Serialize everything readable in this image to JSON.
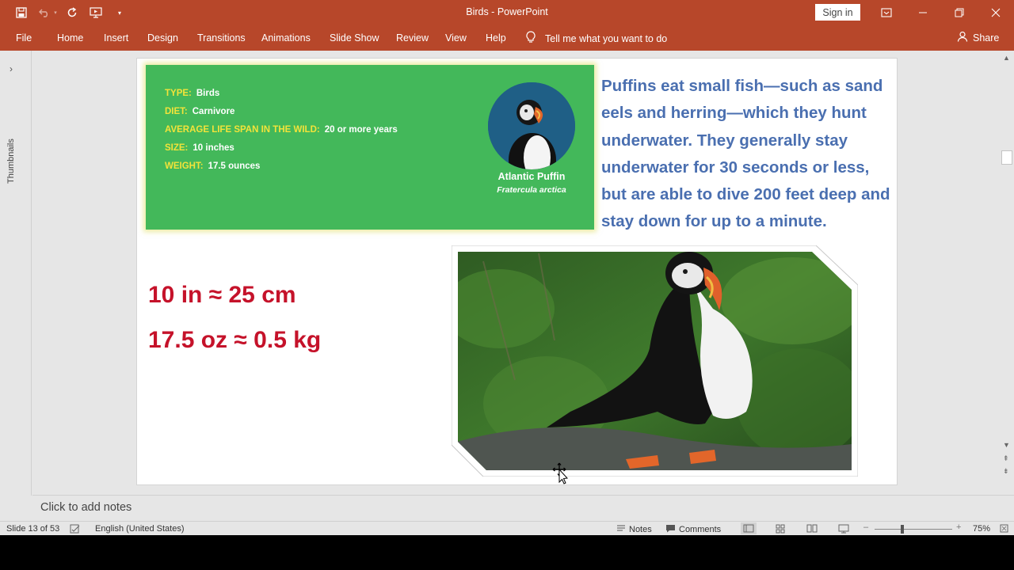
{
  "window": {
    "title": "Birds  -  PowerPoint",
    "sign_in": "Sign in"
  },
  "ribbon": {
    "tabs": [
      "File",
      "Home",
      "Insert",
      "Design",
      "Transitions",
      "Animations",
      "Slide Show",
      "Review",
      "View",
      "Help"
    ],
    "tell_me": "Tell me what you want to do",
    "share": "Share"
  },
  "thumbnails_label": "Thumbnails",
  "slide": {
    "facts": [
      {
        "key": "TYPE:",
        "value": "Birds"
      },
      {
        "key": "DIET:",
        "value": "Carnivore"
      },
      {
        "key": "AVERAGE LIFE SPAN IN THE WILD:",
        "value": "20 or more years"
      },
      {
        "key": "SIZE:",
        "value": "10 inches"
      },
      {
        "key": "WEIGHT:",
        "value": "17.5 ounces"
      }
    ],
    "common_name": "Atlantic Puffin",
    "scientific_name": "Fratercula arctica",
    "diet_paragraph": "Puffins eat small fish—such as sand eels and herring—which they hunt underwater. They generally stay underwater for 30 seconds or less, but are able to dive 200 feet deep and stay down for up to a minute.",
    "conversion_1": "10 in ≈  25 cm",
    "conversion_2": "17.5 oz ≈ 0.5 kg"
  },
  "notes_placeholder": "Click to add notes",
  "status": {
    "slide_counter": "Slide 13 of 53",
    "language": "English (United States)",
    "notes": "Notes",
    "comments": "Comments",
    "zoom": "75%"
  },
  "colors": {
    "accent": "#b7472a",
    "fact_box": "#43b85a",
    "fact_key": "#f2e33a",
    "body_text": "#4a6fb0",
    "conversion_text": "#c5122a"
  }
}
